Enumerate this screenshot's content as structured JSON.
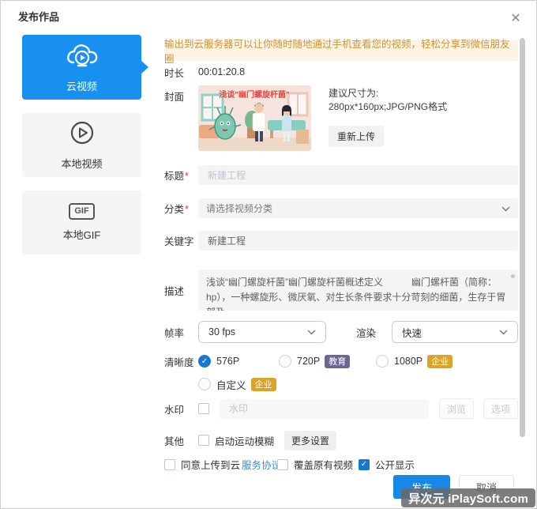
{
  "dialog": {
    "title": "发布作品",
    "close_icon": "✕"
  },
  "icons": {
    "check": "✓"
  },
  "colors": {
    "accent_blue": "#1890f0",
    "publish_blue": "#1788e8",
    "checked_blue": "#1777d2",
    "notice_bg": "#fdf4e4",
    "notice_text": "#d3913a",
    "badge_education": "#6e6596",
    "badge_enterprise": "#dca32b",
    "field_bg": "#f4f4f5"
  },
  "sidebar": {
    "items": [
      {
        "label": "云视频",
        "icon": "cloud-play-icon",
        "active": true
      },
      {
        "label": "本地视频",
        "icon": "play-circle-icon",
        "active": false
      },
      {
        "label": "本地GIF",
        "icon": "gif-icon",
        "icon_text": "GIF",
        "active": false
      }
    ]
  },
  "notice": "输出到云服务器可以让你随时随地通过手机查看您的视频，轻松分享到微信朋友圈",
  "form": {
    "duration": {
      "label": "时长",
      "value": "00:01:20.8"
    },
    "cover": {
      "label": "封面",
      "image_title": "浅谈\"幽门螺旋杆菌\"",
      "hint_line1": "建议尺寸为:",
      "hint_line2": "280px*160px;JPG/PNG格式",
      "reupload_button": "重新上传"
    },
    "title": {
      "label": "标题",
      "required": "*",
      "placeholder": "新建工程",
      "value": ""
    },
    "category": {
      "label": "分类",
      "required": "*",
      "value": "请选择视频分类"
    },
    "keywords": {
      "label": "关键字",
      "value": "新建工程"
    },
    "description": {
      "label": "描述",
      "value": "浅谈“幽门螺旋杆菌”幽门螺旋杆菌概述定义　　　幽门螺杆菌（简称：hp），一种螺旋形、微厌氧、对生长条件要求十分苛刻的细菌，生存于胃部及"
    },
    "framerate": {
      "label": "帧率",
      "value": "30 fps"
    },
    "render": {
      "label": "渲染",
      "value": "快速"
    },
    "clarity": {
      "label": "清晰度",
      "options": [
        {
          "label": "576P",
          "checked": true,
          "badge": ""
        },
        {
          "label": "720P",
          "checked": false,
          "badge": "教育"
        },
        {
          "label": "1080P",
          "checked": false,
          "badge": "企业"
        },
        {
          "label": "自定义",
          "checked": false,
          "badge": "企业"
        }
      ]
    },
    "watermark": {
      "label": "水印",
      "checked": false,
      "placeholder": "水印",
      "browse_button": "浏览",
      "options_button": "选项"
    },
    "other": {
      "label": "其他",
      "checkbox_label": "启动运动模糊",
      "checked": false,
      "more_button": "更多设置"
    }
  },
  "agreements": [
    {
      "label": "同意上传到云",
      "link": "服务协议",
      "checked": false
    },
    {
      "label": "覆盖原有视频",
      "link": "",
      "checked": false
    },
    {
      "label": "公开显示",
      "link": "",
      "checked": true
    }
  ],
  "footer": {
    "publish_button": "发布",
    "cancel_button": "取消"
  },
  "site_watermark": "异次元 iPlaySoft.com"
}
